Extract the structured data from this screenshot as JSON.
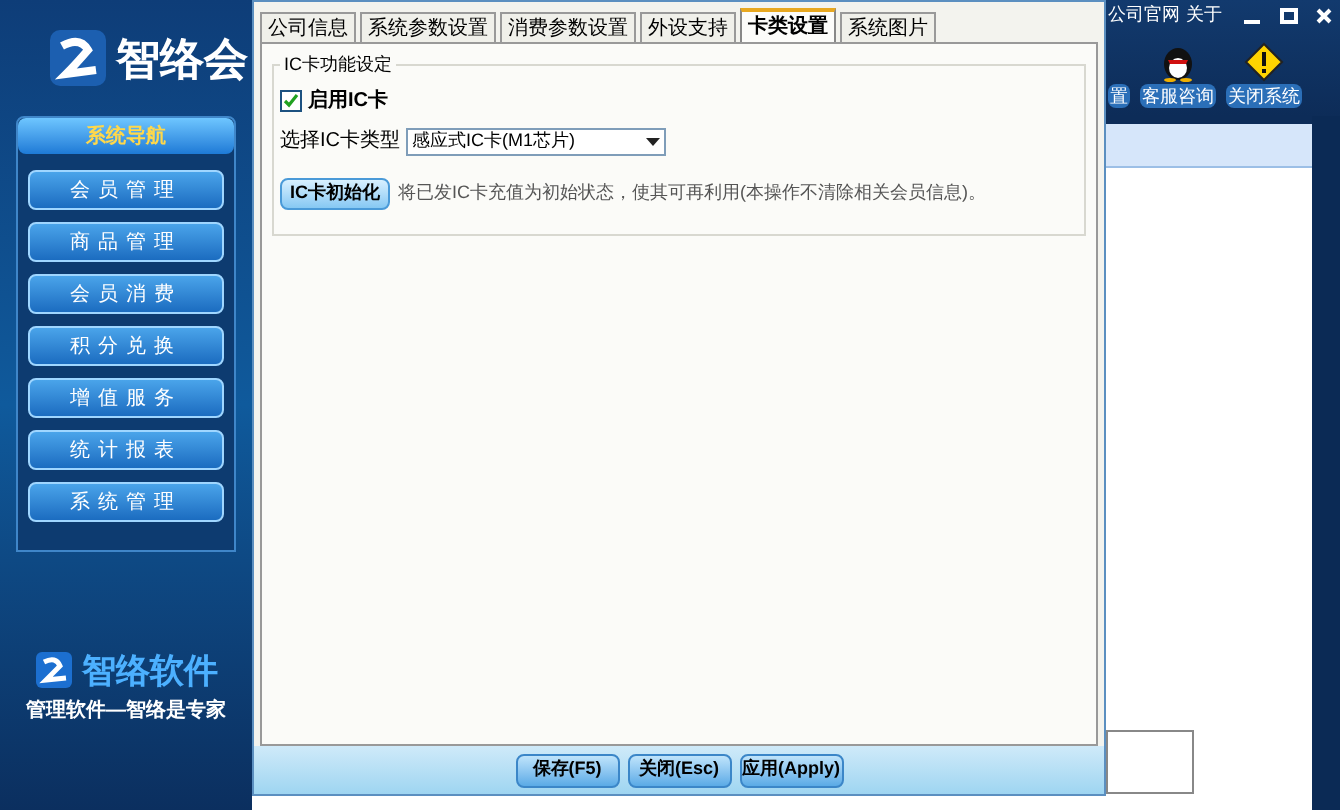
{
  "app": {
    "logo_text": "智络会",
    "nav_title": "系统导航",
    "nav_items": [
      {
        "label": "会员管理"
      },
      {
        "label": "商品管理"
      },
      {
        "label": "会员消费"
      },
      {
        "label": "积分兑换"
      },
      {
        "label": "增值服务"
      },
      {
        "label": "统计报表"
      },
      {
        "label": "系统管理"
      }
    ],
    "brand": "智络软件",
    "slogan": "管理软件—智络是专家",
    "top_links": [
      "公司官网",
      "关于"
    ],
    "toolbar": [
      {
        "label": "置",
        "kind": "cut"
      },
      {
        "label": "客服咨询",
        "kind": "penguin"
      },
      {
        "label": "关闭系统",
        "kind": "warning"
      }
    ]
  },
  "dialog": {
    "tabs": [
      {
        "label": "公司信息",
        "selected": false
      },
      {
        "label": "系统参数设置",
        "selected": false
      },
      {
        "label": "消费参数设置",
        "selected": false
      },
      {
        "label": "外设支持",
        "selected": false
      },
      {
        "label": "卡类设置",
        "selected": true
      },
      {
        "label": "系统图片",
        "selected": false
      }
    ],
    "group_title": "IC卡功能设定",
    "enable_ic": {
      "label": "启用IC卡",
      "checked": true
    },
    "card_type": {
      "label": "选择IC卡类型",
      "value": "感应式IC卡(M1芯片)"
    },
    "init_button": "IC卡初始化",
    "init_note": "将已发IC卡充值为初始状态，使其可再利用(本操作不清除相关会员信息)。",
    "buttons": [
      "保存(F5)",
      "关闭(Esc)",
      "应用(Apply)"
    ]
  }
}
